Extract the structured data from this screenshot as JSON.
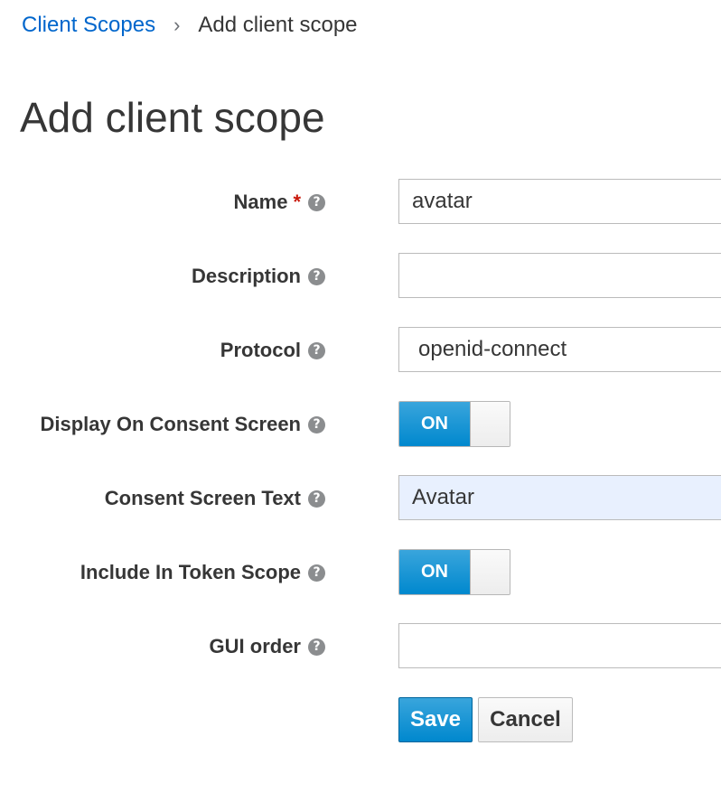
{
  "breadcrumb": {
    "parent": "Client Scopes",
    "separator": "›",
    "current": "Add client scope"
  },
  "page": {
    "title": "Add client scope"
  },
  "form": {
    "help_glyph": "?",
    "required_mark": "*",
    "name": {
      "label": "Name",
      "value": "avatar"
    },
    "description": {
      "label": "Description",
      "value": ""
    },
    "protocol": {
      "label": "Protocol",
      "value": "openid-connect"
    },
    "display_on_consent": {
      "label": "Display On Consent Screen",
      "state": "ON"
    },
    "consent_text": {
      "label": "Consent Screen Text",
      "value": "Avatar"
    },
    "include_in_token": {
      "label": "Include In Token Scope",
      "state": "ON"
    },
    "gui_order": {
      "label": "GUI order",
      "value": ""
    }
  },
  "actions": {
    "save": "Save",
    "cancel": "Cancel"
  },
  "colors": {
    "accent": "#0088ce",
    "link": "#0066cc",
    "required": "#c9190b",
    "autofill_bg": "#e8f0fe"
  },
  "icons": {
    "help": "question-circle-icon",
    "separator": "chevron-right-icon"
  }
}
